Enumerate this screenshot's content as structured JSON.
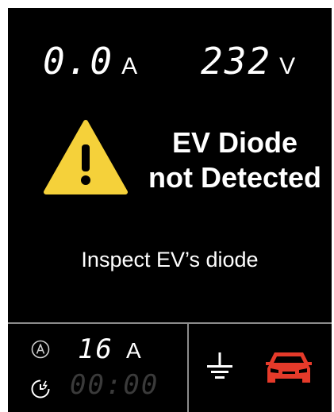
{
  "readouts": {
    "current_value": "0.0",
    "current_unit": "A",
    "voltage_value": "232",
    "voltage_unit": "V"
  },
  "alert": {
    "title_line1": "EV Diode",
    "title_line2": "not Detected",
    "instruction": "Inspect EV’s diode",
    "icon": "warning-triangle-icon",
    "icon_color": "#f5d13a"
  },
  "status_bar": {
    "set_current_icon": "a-circle-icon",
    "set_current_value": "16",
    "set_current_unit": "A",
    "timer_icon": "clock-charge-icon",
    "timer_value": "00:00",
    "ground_icon": "ground-icon",
    "vehicle_icon": "car-icon",
    "vehicle_color": "#e53a2a"
  },
  "colors": {
    "background": "#000000",
    "text": "#ffffff",
    "divider": "#8c8c8c",
    "inactive_segment": "#3a3a3a"
  }
}
